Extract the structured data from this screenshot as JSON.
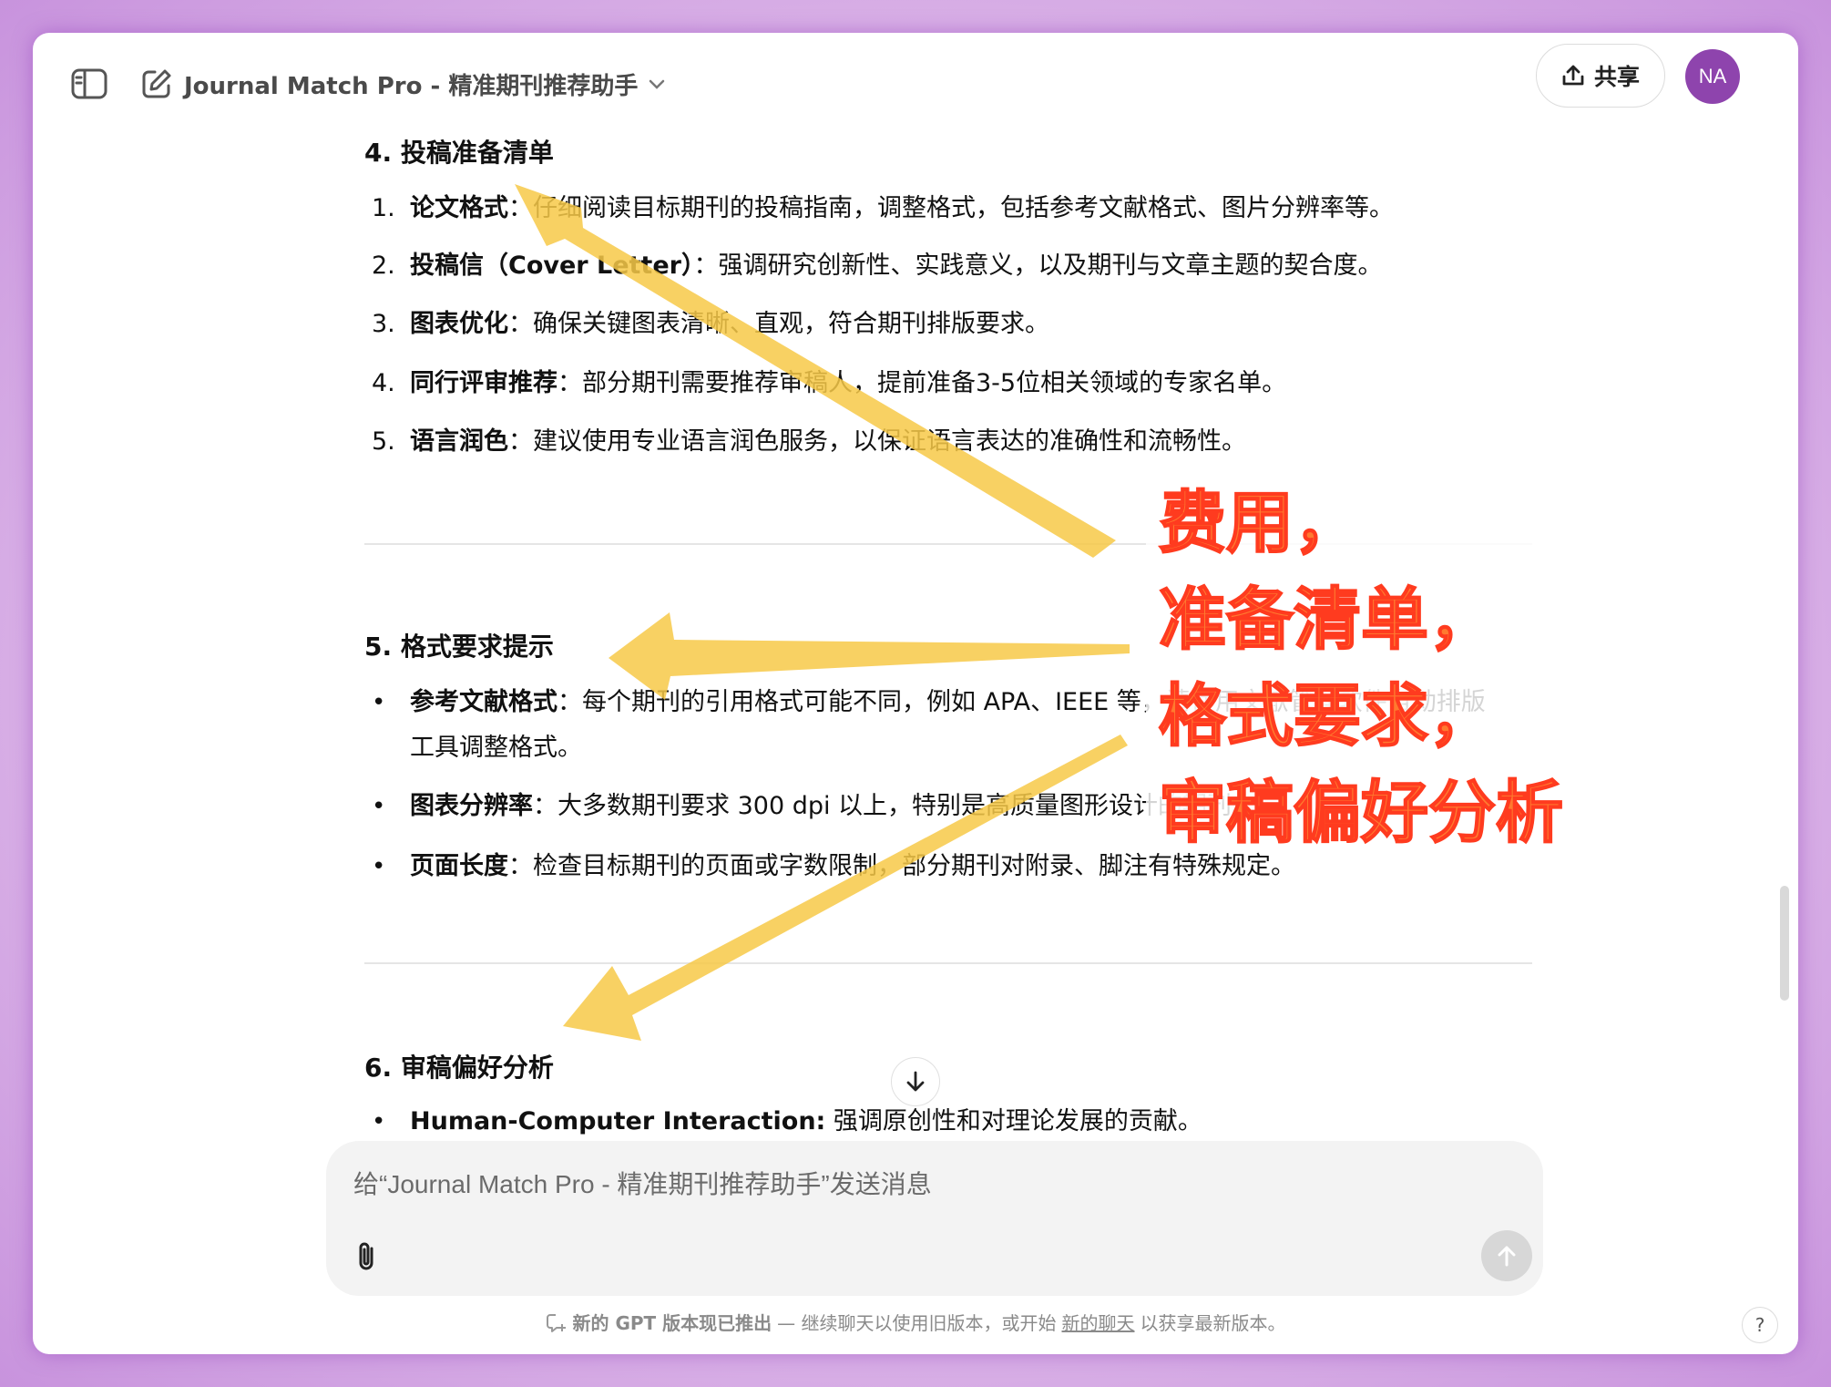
{
  "header": {
    "title": "Journal Match Pro - 精准期刊推荐助手",
    "share_label": "共享",
    "avatar_initials": "NA"
  },
  "sections": {
    "s4": {
      "heading": "4. 投稿准备清单",
      "items": [
        {
          "num": "1.",
          "label": "论文格式",
          "text": "：仔细阅读目标期刊的投稿指南，调整格式，包括参考文献格式、图片分辨率等。"
        },
        {
          "num": "2.",
          "label": "投稿信（Cover Letter）",
          "text": "：强调研究创新性、实践意义，以及期刊与文章主题的契合度。"
        },
        {
          "num": "3.",
          "label": "图表优化",
          "text": "：确保关键图表清晰、直观，符合期刊排版要求。"
        },
        {
          "num": "4.",
          "label": "同行评审推荐",
          "text": "：部分期刊需要推荐审稿人，提前准备3-5位相关领域的专家名单。"
        },
        {
          "num": "5.",
          "label": "语言润色",
          "text": "：建议使用专业语言润色服务，以保证语言表达的准确性和流畅性。"
        }
      ]
    },
    "s5": {
      "heading": "5. 格式要求提示",
      "items": [
        {
          "label": "参考文献格式",
          "text": "：每个期刊的引用格式可能不同，例如 APA、IEEE 等，请使用文献管理软件自动排版",
          "text2": "工具调整格式。"
        },
        {
          "label": "图表分辨率",
          "text": "：大多数期刊要求 300 dpi 以上，特别是高质量图形设计的期刊。"
        },
        {
          "label": "页面长度",
          "text": "：检查目标期刊的页面或字数限制，部分期刊对附录、脚注有特殊规定。"
        }
      ]
    },
    "s6": {
      "heading": "6. 审稿偏好分析",
      "items": [
        {
          "label": "Human-Computer Interaction:",
          "text": " 强调原创性和对理论发展的贡献。"
        }
      ]
    }
  },
  "composer": {
    "placeholder": "给“Journal Match Pro - 精准期刊推荐助手”发送消息"
  },
  "footer": {
    "bold": "新的 GPT 版本现已推出",
    "text1": " — 继续聊天以使用旧版本，或开始",
    "link": "新的聊天",
    "text2": "以获享最新版本。",
    "help": "?"
  },
  "annotation": {
    "lines": [
      "费用，",
      "准备清单，",
      "格式要求，",
      "审稿偏好分析"
    ],
    "text_color": "#ff7a2f",
    "arrow_color": "#f7c948"
  },
  "icons": [
    "sidebar-toggle-icon",
    "new-chat-icon",
    "chevron-down-icon",
    "share-icon",
    "arrow-down-icon",
    "paperclip-icon",
    "arrow-up-icon",
    "new-version-icon"
  ]
}
